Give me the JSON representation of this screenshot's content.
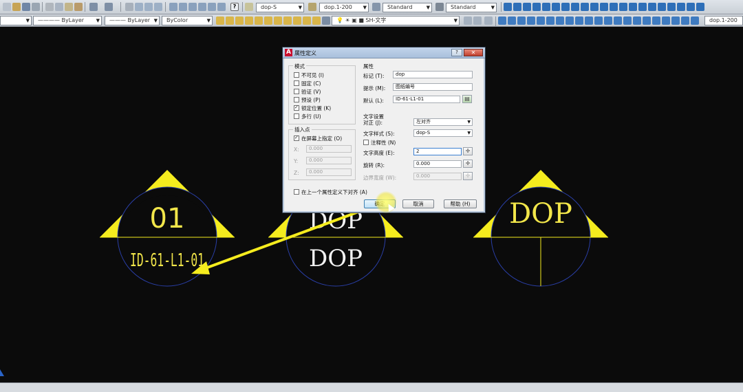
{
  "toolbar": {
    "textstyle": "dop-S",
    "dimstyle": "dop.1-200",
    "tablestyle": "Standard",
    "mleaderstyle": "Standard",
    "layer_linetype": "ByLayer",
    "layer_lineweight": "ByLayer",
    "layer_color": "ByColor",
    "current_layer": "SH-文字",
    "right_style": "dop.1-200"
  },
  "dialog": {
    "title": "属性定义",
    "help_icon": "?",
    "close_icon": "✕",
    "mode": {
      "heading": "模式",
      "items": [
        {
          "label": "不可见 (I)",
          "checked": false
        },
        {
          "label": "固定 (C)",
          "checked": false
        },
        {
          "label": "验证 (V)",
          "checked": false
        },
        {
          "label": "预设 (P)",
          "checked": false
        },
        {
          "label": "锁定位置 (K)",
          "checked": true
        },
        {
          "label": "多行 (U)",
          "checked": false
        }
      ]
    },
    "insertion": {
      "heading": "插入点",
      "onscreen_label": "在屏幕上指定 (O)",
      "onscreen_checked": true,
      "x_label": "X:",
      "x_value": "0.000",
      "y_label": "Y:",
      "y_value": "0.000",
      "z_label": "Z:",
      "z_value": "0.000"
    },
    "attribute": {
      "heading": "属性",
      "tag_label": "标记 (T):",
      "tag_value": "dop",
      "prompt_label": "提示 (M):",
      "prompt_value": "图纸编号",
      "default_label": "默认 (L):",
      "default_value": "ID-61-L1-01"
    },
    "text_settings": {
      "heading": "文字设置",
      "justify_label": "对正 (J):",
      "justify_value": "左对齐",
      "style_label": "文字样式 (S):",
      "style_value": "dop-S",
      "annotative_label": "注释性 (N)",
      "annotative_checked": false,
      "height_label": "文字高度 (E):",
      "height_value": "2",
      "rotation_label": "旋转 (R):",
      "rotation_value": "0.000",
      "boundary_label": "边界宽度 (W):",
      "boundary_value": "0.000"
    },
    "align_below_label": "在上一个属性定义下对齐 (A)",
    "align_below_checked": false,
    "ok_label": "确定",
    "cancel_label": "取消",
    "help_label": "帮助 (H)"
  },
  "drawing": {
    "symbol1_top": "01",
    "symbol1_bottom": "ID-61-L1-01",
    "symbol2_top": "DOP",
    "symbol2_bottom": "DOP",
    "symbol3_top": "DOP"
  },
  "colors": {
    "canvas": "#0b0b0b",
    "symbol_yellow": "#f5ec1e",
    "text_yellow": "#f2e64a",
    "circle_blue": "#2a3fa8",
    "text_white": "#f2f2f2"
  }
}
